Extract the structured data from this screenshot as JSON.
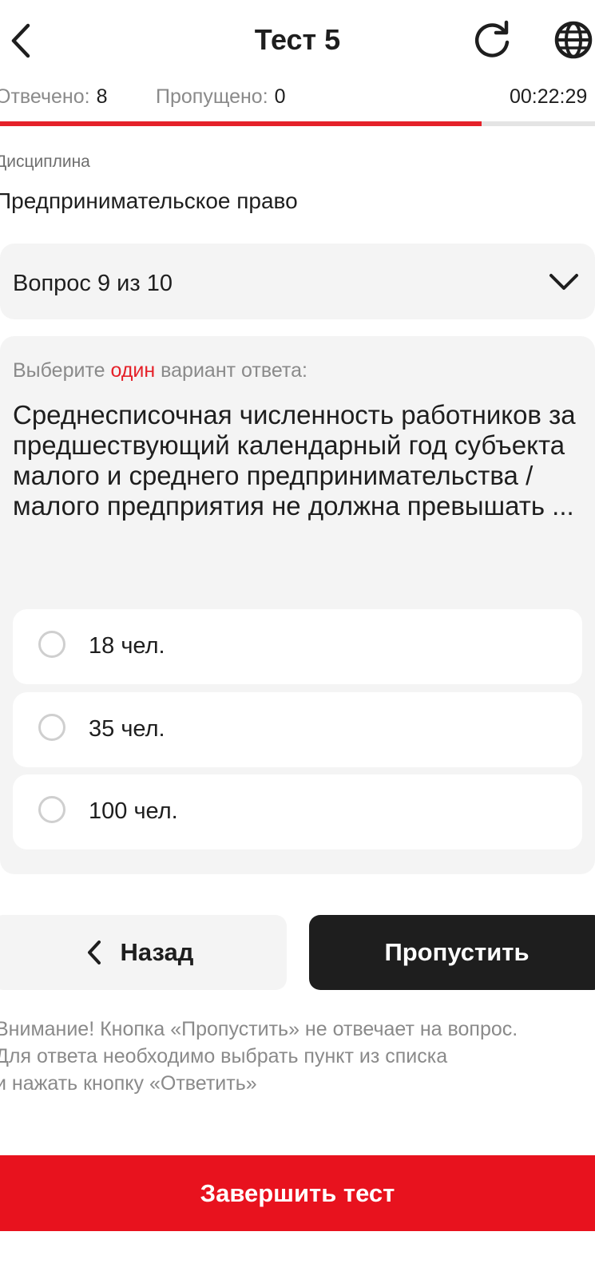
{
  "header": {
    "title": "Тест 5",
    "back_icon": "chevron-left-icon",
    "refresh_icon": "refresh-icon",
    "language_icon": "globe-icon"
  },
  "stats": {
    "answered_label": "Отвечено:",
    "answered_value": "8",
    "skipped_label": "Пропущено:",
    "skipped_value": "0",
    "timer": "00:22:29"
  },
  "progress": {
    "fraction": 0.81,
    "fill_color": "#e52129"
  },
  "discipline": {
    "label": "Дисциплина",
    "value": "Предпринимательское право"
  },
  "question_selector": {
    "label": "Вопрос 9 из 10"
  },
  "question": {
    "instruction_prefix": "Выберите",
    "instruction_accent": "один",
    "instruction_suffix": "вариант ответа:",
    "text": "Среднесписочная численность работников за предшествующий календарный год субъекта малого и среднего предпринимательства / малого предприятия не должна превышать ...",
    "options": [
      {
        "label": "18 чел."
      },
      {
        "label": "35 чел."
      },
      {
        "label": "100 чел."
      }
    ]
  },
  "nav": {
    "back_label": "Назад",
    "skip_label": "Пропустить"
  },
  "notice": {
    "line1": "Внимание! Кнопка «Пропустить» не отвечает на вопрос.",
    "line2": "Для ответа необходимо выбрать пункт из списка",
    "line3": "и нажать кнопку «Ответить»"
  },
  "finish": {
    "label": "Завершить тест"
  },
  "colors": {
    "accent": "#e52129",
    "finish_button": "#e8121e",
    "dark_button": "#1e1e1e",
    "card_bg": "#f4f4f4"
  }
}
